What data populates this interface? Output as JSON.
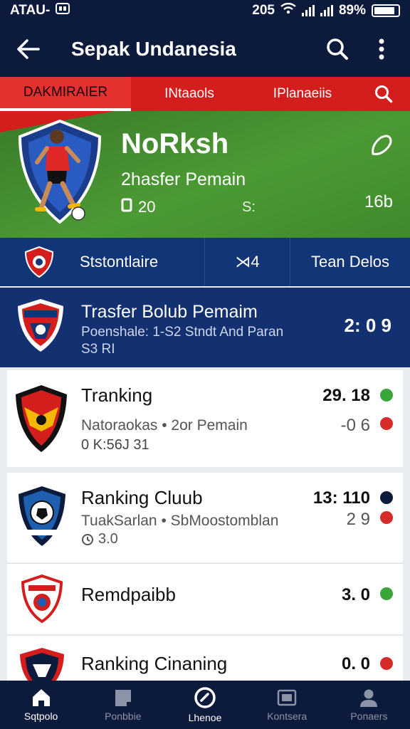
{
  "status_bar": {
    "left_text": "ATAU-",
    "time": "205",
    "battery_text": "89%"
  },
  "app_bar": {
    "title": "Sepak Undanesia"
  },
  "tabs": [
    {
      "label": "DAKMIRAIER",
      "active": true
    },
    {
      "label": "INtaaols",
      "active": false
    },
    {
      "label": "IPlanaeiis",
      "active": false
    }
  ],
  "hero": {
    "name": "NoRksh",
    "subtitle": "2hasfer Pemain",
    "stat_value": "20",
    "mid_text": "S:",
    "right_value": "16b"
  },
  "info_strip": {
    "label": "Ststontlaire",
    "middle": "⋊4",
    "right": "Tean Delos"
  },
  "transfer": {
    "title": "Trasfer Bolub Pemaim",
    "line1": "Poenshale:   1-S2 Stndt And Paran",
    "line2": "S3 RI",
    "score": "2: 0 9"
  },
  "list": [
    {
      "title": "Tranking",
      "sub": "Natoraokas • 2or Pemain",
      "extra": "0 K:56J 31",
      "score_top": "29. 18",
      "score_bottom": "-0 6"
    },
    {
      "title": "Ranking Cluub",
      "sub": "TuakSarlan • SbMoostomblan",
      "extra": "3.0",
      "score_top": "13: 110",
      "score_bottom": "2 9"
    },
    {
      "title": "Remdpaibb",
      "score_top": "3. 0"
    },
    {
      "title": "Ranking Cinaning",
      "score_top": "0. 0"
    }
  ],
  "bottom_nav": [
    {
      "label": "Sqtpolo",
      "icon": "home-icon",
      "active": true
    },
    {
      "label": "Ponbbie",
      "icon": "news-icon",
      "active": false
    },
    {
      "label": "Lhenoe",
      "icon": "ball-icon",
      "active": true
    },
    {
      "label": "Kontsera",
      "icon": "gallery-icon",
      "active": false
    },
    {
      "label": "Ponaers",
      "icon": "profile-icon",
      "active": false
    }
  ],
  "colors": {
    "navy": "#0c1a3c",
    "red": "#d41d1d",
    "green": "#4c9a34",
    "blue": "#123577"
  }
}
